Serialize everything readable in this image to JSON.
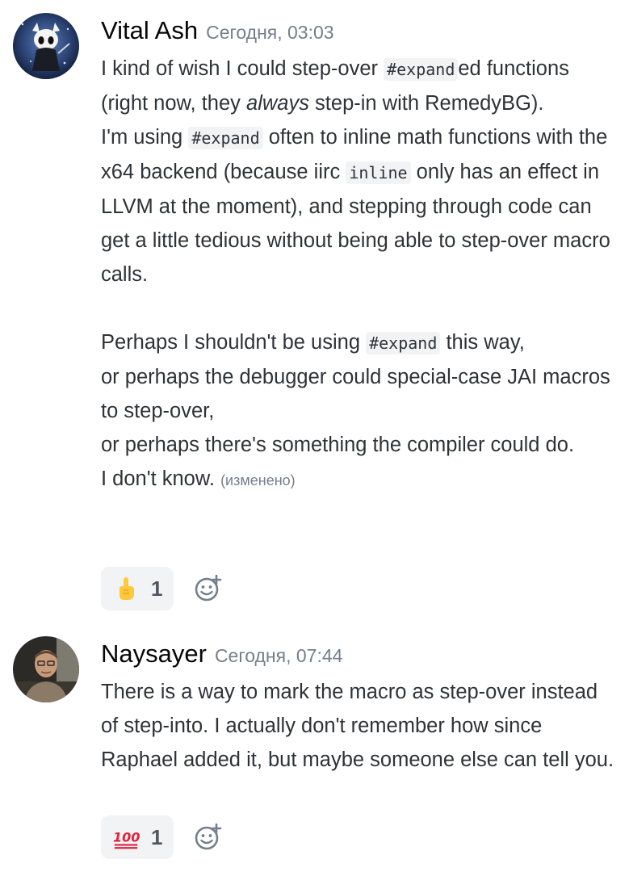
{
  "messages": [
    {
      "author": "Vital Ash",
      "timestamp": "Сегодня, 03:03",
      "text": {
        "l1_a": "I kind of wish I could step-over ",
        "l1_code": "#expand",
        "l1_b": "ed functions (right now, they ",
        "l1_em": "always",
        "l1_c": " step-in with RemedyBG).",
        "l2_a": "I'm using ",
        "l2_code": "#expand",
        "l2_b": " often to inline math functions with the x64 backend (because iirc ",
        "l2_code2": "inline",
        "l2_c": " only has an effect in LLVM at the moment), and stepping through code can get a little tedious without being able to step-over macro calls.",
        "l3_a": "Perhaps I shouldn't be using ",
        "l3_code": "#expand",
        "l3_b": " this way,",
        "l4": "or perhaps the debugger could special-case JAI macros to step-over,",
        "l5": "or perhaps there's something the compiler could do.",
        "l6": "I don't know.",
        "edited": "(изменено)"
      },
      "reaction": {
        "emoji": "pointing-up-hand",
        "count": "1"
      }
    },
    {
      "author": "Naysayer",
      "timestamp": "Сегодня, 07:44",
      "text": {
        "l1": "There is a way to mark the macro as step-over instead of step-into. I actually don't remember how since Raphael added it, but maybe someone else can tell you."
      },
      "reaction": {
        "emoji": "hundred-points",
        "count": "1"
      }
    }
  ],
  "colors": {
    "author": "#060607",
    "timestamp": "#747f8d",
    "body": "#2e3338",
    "reaction_bg": "#f2f3f5"
  }
}
